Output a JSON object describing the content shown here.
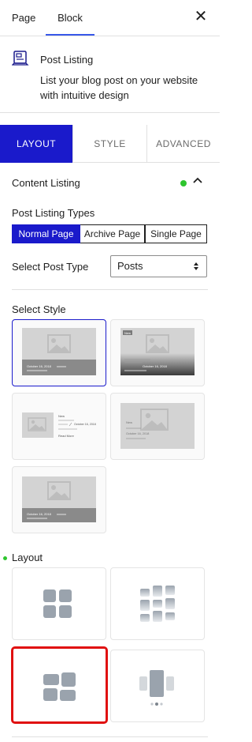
{
  "top_tabs": {
    "page": "Page",
    "block": "Block"
  },
  "close_icon": "close-icon",
  "block": {
    "icon": "post-listing-icon",
    "title": "Post Listing",
    "description": "List your blog post on your website with intuitive design"
  },
  "inner_tabs": {
    "layout": "LAYOUT",
    "style": "STYLE",
    "advanced": "ADVANCED"
  },
  "content_listing": {
    "title": "Content Listing",
    "status_color": "#2ec52e",
    "types_label": "Post Listing Types",
    "types": [
      "Normal Page",
      "Archive Page",
      "Single Page"
    ],
    "selected_type": "Normal Page",
    "post_type_label": "Select Post Type",
    "post_type_value": "Posts"
  },
  "select_style": {
    "label": "Select Style",
    "card_texts": {
      "date": "October 16, 2018",
      "new": "New",
      "read_more": "Read More"
    }
  },
  "layout": {
    "label": "Layout"
  },
  "colors": {
    "accent": "#1a1acb",
    "highlight": "#e01010",
    "active_dot": "#2ec52e"
  }
}
